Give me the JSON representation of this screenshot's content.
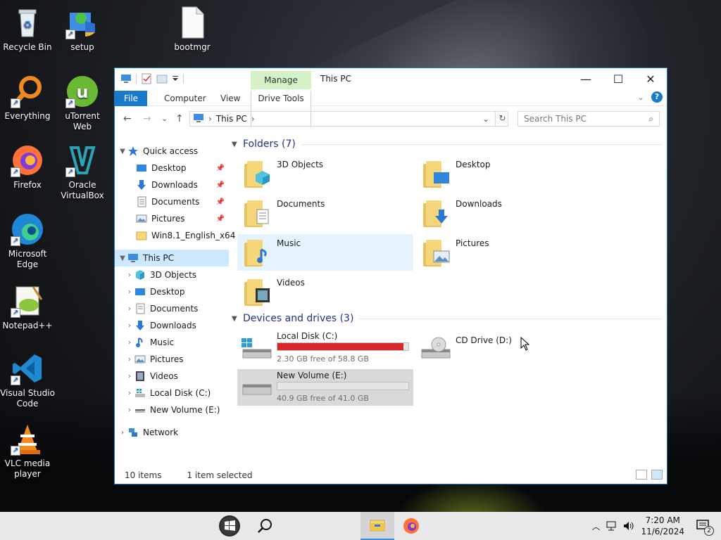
{
  "desktop": {
    "icons": [
      {
        "label": "Recycle Bin",
        "icon": "recycle-bin-icon"
      },
      {
        "label": "setup",
        "icon": "setup-installer-icon"
      },
      {
        "label": "bootmgr",
        "icon": "file-icon"
      },
      {
        "label": "Everything",
        "icon": "everything-search-icon"
      },
      {
        "label": "uTorrent Web",
        "icon": "utorrent-icon"
      },
      {
        "label": "Firefox",
        "icon": "firefox-icon"
      },
      {
        "label": "Oracle VirtualBox",
        "icon": "virtualbox-icon"
      },
      {
        "label": "Microsoft Edge",
        "icon": "edge-icon"
      },
      {
        "label": "Notepad++",
        "icon": "notepadpp-icon"
      },
      {
        "label": "Visual Studio Code",
        "icon": "vscode-icon"
      },
      {
        "label": "VLC media player",
        "icon": "vlc-icon"
      }
    ]
  },
  "window": {
    "title": "This PC",
    "manage_tab": "Manage",
    "ribbon_tabs": {
      "file": "File",
      "computer": "Computer",
      "view": "View",
      "drive_tools": "Drive Tools"
    },
    "help": "?",
    "caption": {
      "minimize": "—",
      "maximize": "☐",
      "close": "✕"
    }
  },
  "navbar": {
    "back": "←",
    "forward": "→",
    "recent": "⌄",
    "up": "↑",
    "address": "This PC",
    "address_sep": "›",
    "refresh": "↻",
    "search_placeholder": "Search This PC"
  },
  "navpane": {
    "quick_access": "Quick access",
    "quick_items": [
      "Desktop",
      "Downloads",
      "Documents",
      "Pictures",
      "Win8.1_English_x64"
    ],
    "this_pc": "This PC",
    "pc_items": [
      "3D Objects",
      "Desktop",
      "Documents",
      "Downloads",
      "Music",
      "Pictures",
      "Videos",
      "Local Disk (C:)",
      "New Volume (E:)"
    ],
    "network": "Network"
  },
  "content": {
    "folders_header": "Folders (7)",
    "folders": [
      "3D Objects",
      "Desktop",
      "Documents",
      "Downloads",
      "Music",
      "Pictures",
      "Videos"
    ],
    "drives_header": "Devices and drives (3)",
    "drives": [
      {
        "name": "Local Disk (C:)",
        "free": "2.30 GB free of 58.8 GB",
        "used_fraction": 0.96,
        "bar_color": "#da2626"
      },
      {
        "name": "CD Drive (D:)"
      },
      {
        "name": "New Volume (E:)",
        "free": "40.9 GB free of 41.0 GB",
        "used_fraction": 0.0,
        "bar_color": "#26a0da"
      }
    ]
  },
  "status": {
    "items": "10 items",
    "selected": "1 item selected"
  },
  "taskbar": {
    "time": "7:20 AM",
    "date": "11/6/2024",
    "notifications": "2"
  }
}
